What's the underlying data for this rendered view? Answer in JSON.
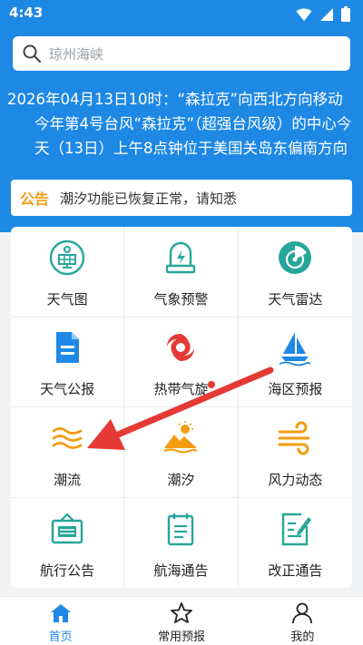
{
  "status_bar": {
    "time": "4:43"
  },
  "search": {
    "placeholder": "琼州海峡"
  },
  "news": {
    "line1": "2026年04月13日10时：“森拉克”向西北方向移动",
    "line2": "今年第4号台风“森拉克”（超强台风级）的中心今天（13日）上午8点钟位于美国关岛东偏南方向"
  },
  "notice": {
    "label": "公告",
    "text": "潮汐功能已恢复正常，请知悉"
  },
  "grid": {
    "items": [
      {
        "label": "天气图",
        "icon": "weather-map-icon"
      },
      {
        "label": "气象预警",
        "icon": "weather-warning-icon"
      },
      {
        "label": "天气雷达",
        "icon": "weather-radar-icon"
      },
      {
        "label": "天气公报",
        "icon": "weather-bulletin-icon"
      },
      {
        "label": "热带气旋",
        "icon": "tropical-cyclone-icon"
      },
      {
        "label": "海区预报",
        "icon": "sea-area-forecast-icon"
      },
      {
        "label": "潮流",
        "icon": "tidal-current-icon"
      },
      {
        "label": "潮汐",
        "icon": "tide-icon"
      },
      {
        "label": "风力动态",
        "icon": "wind-dynamics-icon"
      },
      {
        "label": "航行公告",
        "icon": "navigation-notice-icon"
      },
      {
        "label": "航海通告",
        "icon": "nautical-notice-icon"
      },
      {
        "label": "改正通告",
        "icon": "correction-notice-icon"
      }
    ]
  },
  "bottom_nav": {
    "items": [
      {
        "label": "首页",
        "icon": "home-icon"
      },
      {
        "label": "常用预报",
        "icon": "star-icon"
      },
      {
        "label": "我的",
        "icon": "user-icon"
      }
    ]
  },
  "colors": {
    "primary": "#1e88e5",
    "accent_green": "#26a69a",
    "accent_orange": "#f39c12",
    "accent_red": "#e53935"
  }
}
